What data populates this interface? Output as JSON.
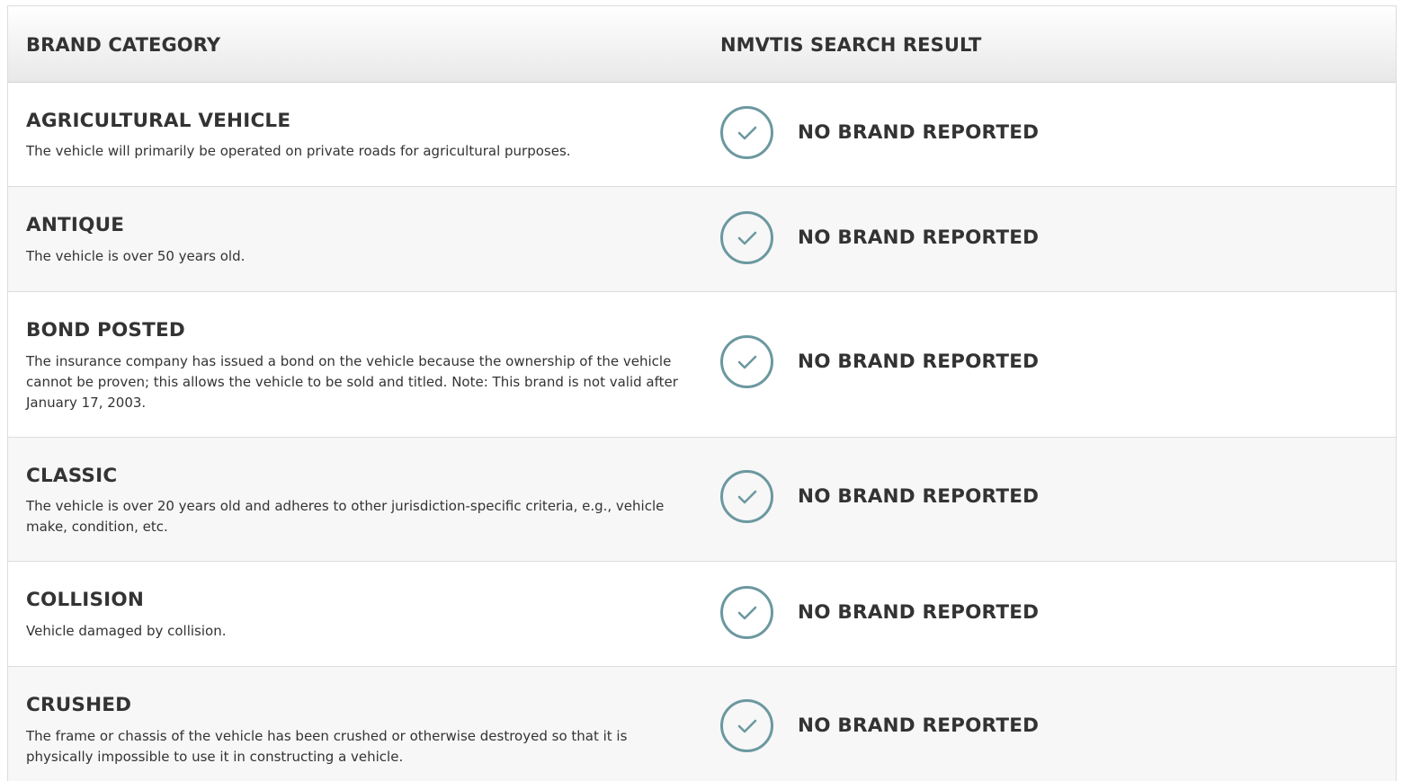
{
  "header": {
    "col_category": "BRAND CATEGORY",
    "col_result": "NMVTIS SEARCH RESULT"
  },
  "accent_color": "#6c98a0",
  "rows": [
    {
      "name": "AGRICULTURAL VEHICLE",
      "description": "The vehicle will primarily be operated on private roads for agricultural purposes.",
      "status": "NO BRAND REPORTED",
      "status_icon": "check-circle-icon"
    },
    {
      "name": "ANTIQUE",
      "description": "The vehicle is over 50 years old.",
      "status": "NO BRAND REPORTED",
      "status_icon": "check-circle-icon"
    },
    {
      "name": "BOND POSTED",
      "description": "The insurance company has issued a bond on the vehicle because the ownership of the vehicle cannot be proven; this allows the vehicle to be sold and titled. Note: This brand is not valid after January 17, 2003.",
      "status": "NO BRAND REPORTED",
      "status_icon": "check-circle-icon"
    },
    {
      "name": "CLASSIC",
      "description": "The vehicle is over 20 years old and adheres to other jurisdiction-specific criteria, e.g., vehicle make, condition, etc.",
      "status": "NO BRAND REPORTED",
      "status_icon": "check-circle-icon"
    },
    {
      "name": "COLLISION",
      "description": "Vehicle damaged by collision.",
      "status": "NO BRAND REPORTED",
      "status_icon": "check-circle-icon"
    },
    {
      "name": "CRUSHED",
      "description": "The frame or chassis of the vehicle has been crushed or otherwise destroyed so that it is physically impossible to use it in constructing a vehicle.",
      "status": "NO BRAND REPORTED",
      "status_icon": "check-circle-icon"
    }
  ]
}
